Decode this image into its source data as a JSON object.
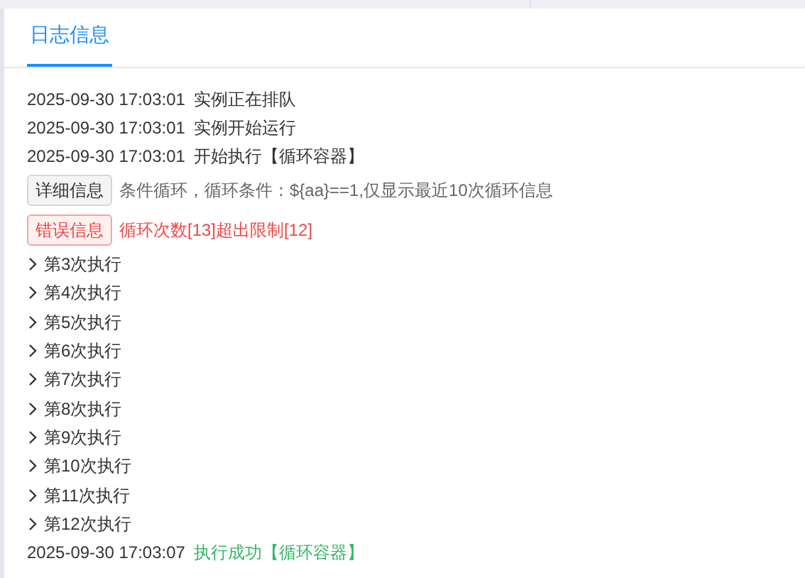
{
  "tabs": [
    {
      "label": "日志信息",
      "selected": true
    }
  ],
  "entries": [
    {
      "kind": "log",
      "time": "2025-09-30 17:03:01",
      "message": "实例正在排队",
      "success": false
    },
    {
      "kind": "log",
      "time": "2025-09-30 17:03:01",
      "message": "实例开始运行",
      "success": false
    },
    {
      "kind": "log",
      "time": "2025-09-30 17:03:01",
      "message": "开始执行【循环容器】",
      "success": false
    },
    {
      "kind": "tag",
      "tag": "详细信息",
      "text": "条件循环，循环条件：${aa}==1,仅显示最近10次循环信息",
      "error": false
    },
    {
      "kind": "tag",
      "tag": "错误信息",
      "text": "循环次数[13]超出限制[12]",
      "error": true
    },
    {
      "kind": "iteration",
      "label": "第3次执行",
      "expanded": false
    },
    {
      "kind": "iteration",
      "label": "第4次执行",
      "expanded": false
    },
    {
      "kind": "iteration",
      "label": "第5次执行",
      "expanded": false
    },
    {
      "kind": "iteration",
      "label": "第6次执行",
      "expanded": false
    },
    {
      "kind": "iteration",
      "label": "第7次执行",
      "expanded": false
    },
    {
      "kind": "iteration",
      "label": "第8次执行",
      "expanded": false
    },
    {
      "kind": "iteration",
      "label": "第9次执行",
      "expanded": false
    },
    {
      "kind": "iteration",
      "label": "第10次执行",
      "expanded": false
    },
    {
      "kind": "iteration",
      "label": "第11次执行",
      "expanded": false
    },
    {
      "kind": "iteration",
      "label": "第12次执行",
      "expanded": false
    },
    {
      "kind": "log",
      "time": "2025-09-30 17:03:07",
      "message": "执行成功【循环容器】",
      "success": true
    }
  ]
}
